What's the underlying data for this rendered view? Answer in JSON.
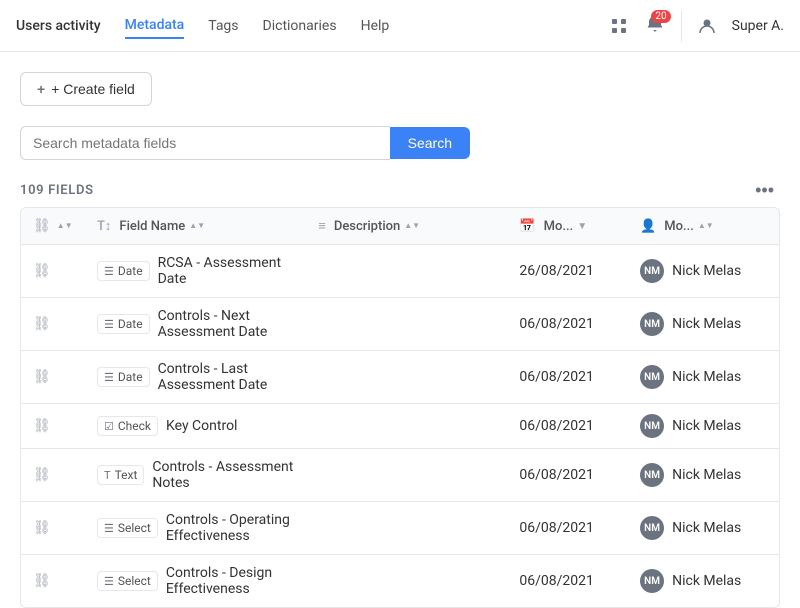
{
  "header": {
    "title": "Users activity",
    "nav": [
      {
        "id": "users-activity",
        "label": "Users activity",
        "active": false
      },
      {
        "id": "metadata",
        "label": "Metadata",
        "active": true
      },
      {
        "id": "tags",
        "label": "Tags",
        "active": false
      },
      {
        "id": "dictionaries",
        "label": "Dictionaries",
        "active": false
      },
      {
        "id": "help",
        "label": "Help",
        "active": false
      }
    ],
    "notifications_count": "20",
    "user_label": "Super A."
  },
  "toolbar": {
    "create_btn_label": "+ Create field"
  },
  "search": {
    "placeholder": "Search metadata fields",
    "button_label": "Search"
  },
  "fields": {
    "count_label": "109 FIELDS",
    "columns": [
      {
        "id": "link",
        "label": ""
      },
      {
        "id": "field_name",
        "label": "Field Name"
      },
      {
        "id": "description",
        "label": "Description"
      },
      {
        "id": "modified",
        "label": "Mo..."
      },
      {
        "id": "modified_by",
        "label": "Mo..."
      }
    ],
    "rows": [
      {
        "type": "Date",
        "type_icon": "☰",
        "field_name": "RCSA - Assessment Date",
        "description": "",
        "modified": "26/08/2021",
        "modified_by": "Nick Melas",
        "avatar": "NM"
      },
      {
        "type": "Date",
        "type_icon": "☰",
        "field_name": "Controls - Next Assessment Date",
        "description": "",
        "modified": "06/08/2021",
        "modified_by": "Nick Melas",
        "avatar": "NM"
      },
      {
        "type": "Date",
        "type_icon": "☰",
        "field_name": "Controls - Last Assessment Date",
        "description": "",
        "modified": "06/08/2021",
        "modified_by": "Nick Melas",
        "avatar": "NM"
      },
      {
        "type": "Check",
        "type_icon": "☑",
        "field_name": "Key Control",
        "description": "",
        "modified": "06/08/2021",
        "modified_by": "Nick Melas",
        "avatar": "NM"
      },
      {
        "type": "Text",
        "type_icon": "T",
        "field_name": "Controls - Assessment Notes",
        "description": "",
        "modified": "06/08/2021",
        "modified_by": "Nick Melas",
        "avatar": "NM"
      },
      {
        "type": "Select",
        "type_icon": "☰",
        "field_name": "Controls - Operating Effectiveness",
        "description": "",
        "modified": "06/08/2021",
        "modified_by": "Nick Melas",
        "avatar": "NM"
      },
      {
        "type": "Select",
        "type_icon": "☰",
        "field_name": "Controls - Design Effectiveness",
        "description": "",
        "modified": "06/08/2021",
        "modified_by": "Nick Melas",
        "avatar": "NM"
      }
    ]
  }
}
